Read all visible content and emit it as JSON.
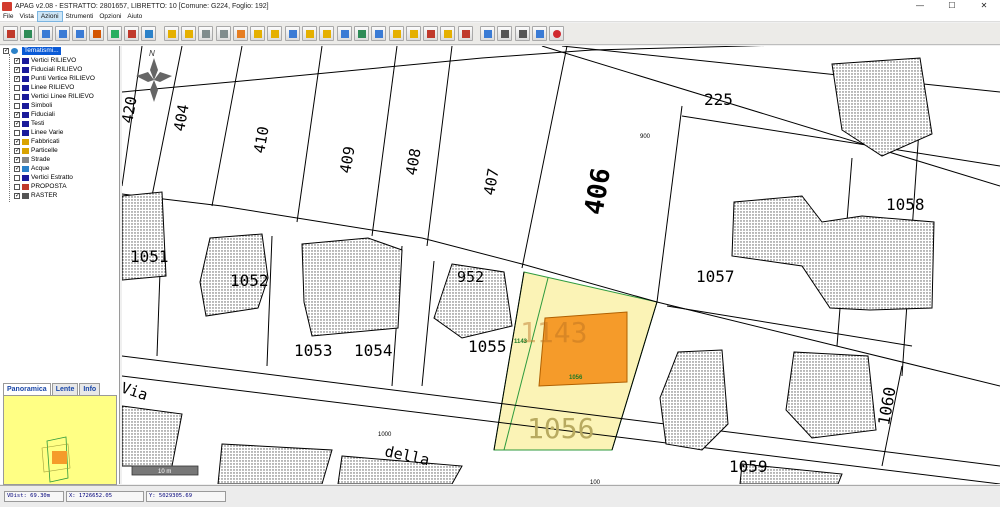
{
  "window": {
    "title": "APAG v2.08 - ESTRATTO: 2801657, LIBRETTO: 10 [Comune: G224, Foglio: 192]",
    "controls": [
      "—",
      "☐",
      "✕"
    ]
  },
  "menu": [
    "File",
    "Vista",
    "Azioni",
    "Strumenti",
    "Opzioni",
    "Aiuto"
  ],
  "menu_active": "Azioni",
  "toolbar": {
    "buttons": [
      {
        "icon": "edit-icon",
        "color": "#c0392b"
      },
      {
        "icon": "zoom-window-icon",
        "color": "#2e8b57"
      },
      {
        "icon": "zoom-in-icon",
        "color": "#3a7bd5"
      },
      {
        "icon": "zoom-out-icon",
        "color": "#3a7bd5"
      },
      {
        "icon": "zoom-extent-icon",
        "color": "#3a7bd5"
      },
      {
        "icon": "pan-icon",
        "color": "#d35400"
      },
      {
        "icon": "grid-icon",
        "color": "#27ae60"
      },
      {
        "icon": "snap-icon",
        "color": "#c0392b"
      },
      {
        "icon": "globe-icon",
        "color": "#2c82c9"
      },
      {
        "icon": "layer-icon",
        "color": "#e5b000"
      },
      {
        "icon": "table-icon",
        "color": "#e5b000"
      },
      {
        "icon": "stamp-icon",
        "color": "#7f8c8d"
      },
      {
        "icon": "measure-icon",
        "color": "#7f8c8d"
      },
      {
        "icon": "point-icon",
        "color": "#e67e22"
      },
      {
        "icon": "line-icon",
        "color": "#e5b000"
      },
      {
        "icon": "area-icon",
        "color": "#e5b000"
      },
      {
        "icon": "select-icon",
        "color": "#3a7bd5"
      },
      {
        "icon": "polygon-icon",
        "color": "#e5b000"
      },
      {
        "icon": "text-icon",
        "color": "#e5b000"
      },
      {
        "icon": "symbol-icon",
        "color": "#3a7bd5"
      },
      {
        "icon": "export-icon",
        "color": "#2e8b57"
      },
      {
        "icon": "import-icon",
        "color": "#3a7bd5"
      },
      {
        "icon": "document-icon",
        "color": "#e5b000"
      },
      {
        "icon": "pencil-icon",
        "color": "#e5b000"
      },
      {
        "icon": "flag-icon",
        "color": "#c0392b"
      },
      {
        "icon": "page-icon",
        "color": "#e5b000"
      },
      {
        "icon": "book-icon",
        "color": "#c0392b"
      },
      {
        "icon": "window-icon",
        "color": "#3a7bd5"
      },
      {
        "icon": "print-preview-icon",
        "color": "#555555"
      },
      {
        "icon": "print-icon",
        "color": "#555555"
      },
      {
        "icon": "settings-icon",
        "color": "#3a7bd5"
      },
      {
        "icon": "exit-icon",
        "color": "#d0282e"
      }
    ]
  },
  "layers": {
    "root_label": "Tematismi...",
    "items": [
      {
        "label": "Vertici RILIEVO",
        "checked": true,
        "color": "#1a1a9a"
      },
      {
        "label": "Fiduciali RILIEVO",
        "checked": true,
        "color": "#1a1a9a"
      },
      {
        "label": "Punti Vertice RILIEVO",
        "checked": true,
        "color": "#1a1a9a"
      },
      {
        "label": "Linee RILIEVO",
        "checked": false,
        "color": "#1a1a9a"
      },
      {
        "label": "Vertici Linee RILIEVO",
        "checked": false,
        "color": "#1a1a9a"
      },
      {
        "label": "Simboli",
        "checked": false,
        "color": "#1a1a9a"
      },
      {
        "label": "Fiduciali",
        "checked": true,
        "color": "#1a1a9a"
      },
      {
        "label": "Testi",
        "checked": true,
        "color": "#1a1a9a"
      },
      {
        "label": "Linee Varie",
        "checked": false,
        "color": "#1a1a9a"
      },
      {
        "label": "Fabbricati",
        "checked": true,
        "color": "#d9a300"
      },
      {
        "label": "Particelle",
        "checked": true,
        "color": "#d9a300"
      },
      {
        "label": "Strade",
        "checked": true,
        "color": "#888888"
      },
      {
        "label": "Acque",
        "checked": true,
        "color": "#2c82c9"
      },
      {
        "label": "Vertici Estratto",
        "checked": false,
        "color": "#1a1a9a"
      },
      {
        "label": "PROPOSTA",
        "checked": false,
        "color": "#c0392b"
      },
      {
        "label": "RASTER",
        "checked": true,
        "color": "#555555"
      }
    ]
  },
  "panel_tabs": [
    "Panoramica",
    "Lente",
    "Info"
  ],
  "panel_tab_active": "Panoramica",
  "map": {
    "north_label": "N",
    "parcel_labels": [
      "420",
      "404",
      "410",
      "409",
      "408",
      "407",
      "406",
      "225",
      "1058",
      "1057",
      "1051",
      "1052",
      "952",
      "1053",
      "1054",
      "1055",
      "1143",
      "1056",
      "1059",
      "1060"
    ],
    "small_labels": [
      "900",
      "1000",
      "100"
    ],
    "selected_parcel_labels": [
      "1143",
      "1056"
    ],
    "road_labels": [
      "Via",
      "della"
    ],
    "scale_label": "10 m",
    "colors": {
      "selected_parcel_fill": "#fbf3b6",
      "building_fill": "#f59b2a",
      "building_pattern": "#888888",
      "selection_edge": "#2e9a3e"
    }
  },
  "status": {
    "dist": "VDist: 69.30m",
    "x": "X: 1726652.05",
    "y": "Y: 5029305.69"
  }
}
